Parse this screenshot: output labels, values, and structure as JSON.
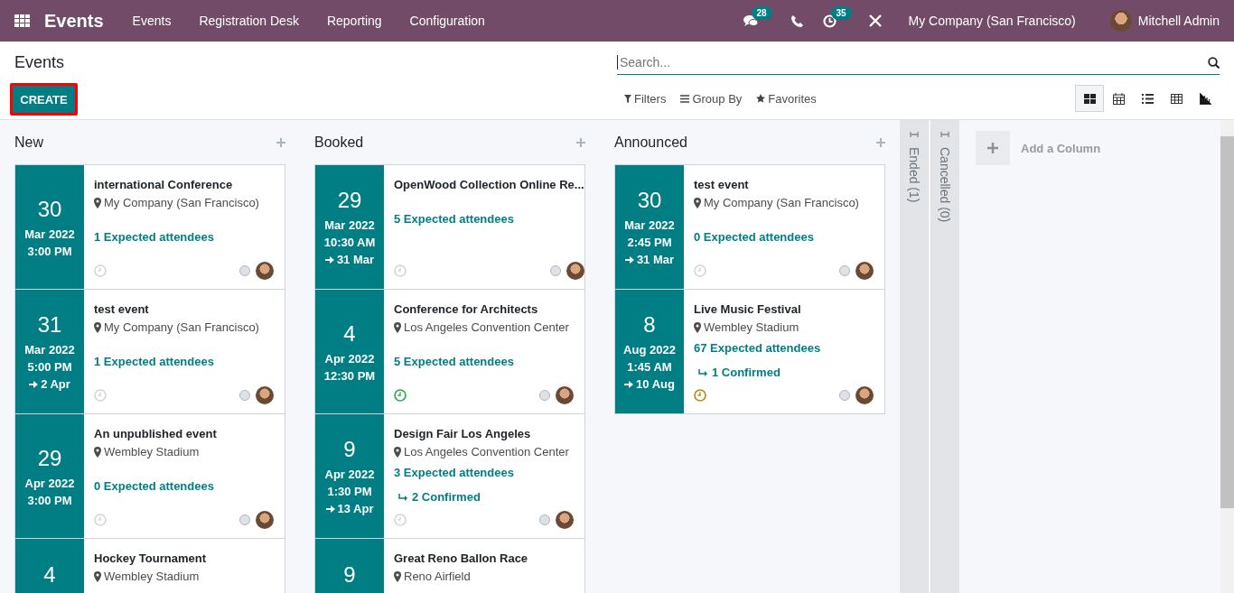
{
  "navbar": {
    "app": "Events",
    "menus": [
      "Events",
      "Registration Desk",
      "Reporting",
      "Configuration"
    ],
    "messages_count": "28",
    "activities_count": "35",
    "company": "My Company (San Francisco)",
    "user": "Mitchell Admin"
  },
  "control_panel": {
    "title": "Events",
    "create": "CREATE",
    "search": {
      "placeholder": "Search..."
    },
    "filters": [
      "Filters",
      "Group By",
      "Favorites"
    ],
    "views": [
      {
        "kind": "kanban",
        "selected": true
      },
      {
        "kind": "calendar",
        "selected": false
      },
      {
        "kind": "list",
        "selected": false
      },
      {
        "kind": "pivot",
        "selected": false
      },
      {
        "kind": "graph",
        "selected": false
      }
    ]
  },
  "columns": [
    {
      "title": "New",
      "cards": [
        {
          "day": "30",
          "month": "Mar 2022",
          "time": "3:00 PM",
          "name": "international Conference",
          "location": "My Company (San Francisco)",
          "attendees": "1 Expected attendees",
          "color": "#d4d4d4"
        },
        {
          "day": "31",
          "month": "Mar 2022",
          "time": "5:00 PM",
          "end": "2 Apr",
          "name": "test event",
          "location": "My Company (San Francisco)",
          "attendees": "1 Expected attendees",
          "color": "#d4d4d4"
        },
        {
          "day": "29",
          "month": "Apr 2022",
          "time": "3:00 PM",
          "name": "An unpublished event",
          "location": "Wembley Stadium",
          "attendees": "0 Expected attendees",
          "color": "#d4d4d4"
        },
        {
          "day": "4",
          "name": "Hockey Tournament",
          "location": "Wembley Stadium"
        }
      ]
    },
    {
      "title": "Booked",
      "cards": [
        {
          "day": "29",
          "month": "Mar 2022",
          "time": "10:30 AM",
          "end": "31 Mar",
          "name": "OpenWood Collection Online Re...",
          "attendees": "5 Expected attendees",
          "color": "#d4d4d4"
        },
        {
          "day": "4",
          "month": "Apr 2022",
          "time": "12:30 PM",
          "name": "Conference for Architects",
          "location": "Los Angeles Convention Center",
          "attendees": "5 Expected attendees",
          "color": "#28a745"
        },
        {
          "day": "9",
          "month": "Apr 2022",
          "time": "1:30 PM",
          "end": "13 Apr",
          "name": "Design Fair Los Angeles",
          "location": "Los Angeles Convention Center",
          "attendees": "3 Expected attendees",
          "confirmed": "2 Confirmed",
          "color": "#d4d4d4"
        },
        {
          "day": "9",
          "name": "Great Reno Ballon Race",
          "location": "Reno Airfield"
        }
      ]
    },
    {
      "title": "Announced",
      "cards": [
        {
          "day": "30",
          "month": "Mar 2022",
          "time": "2:45 PM",
          "end": "31 Mar",
          "name": "test event",
          "location": "My Company (San Francisco)",
          "attendees": "0 Expected attendees",
          "color": "#d4d4d4"
        },
        {
          "day": "8",
          "month": "Aug 2022",
          "time": "1:45 AM",
          "end": "10 Aug",
          "name": "Live Music Festival",
          "location": "Wembley Stadium",
          "attendees": "67 Expected attendees",
          "confirmed": "1 Confirmed",
          "color": "#b8860b"
        }
      ]
    }
  ],
  "folded_columns": [
    "Ended (1)",
    "Cancelled (0)"
  ],
  "add_column": "Add a Column"
}
